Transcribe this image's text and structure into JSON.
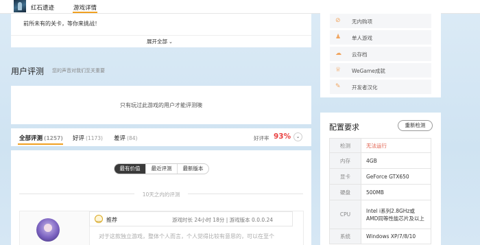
{
  "header": {
    "game_name": "红石遗迹",
    "tab_detail": "游戏详情"
  },
  "intro": {
    "text": "前所未有的关卡，等你来挑战！",
    "expand_label": "展开全部"
  },
  "reviews_section": {
    "title": "用户评测",
    "subtitle": "您的声音对我们至关重要",
    "notice": "只有玩过此游戏的用户才能评测噢",
    "tabs": [
      {
        "label": "全部评测",
        "count": "(1257)"
      },
      {
        "label": "好评",
        "count": "(1173)"
      },
      {
        "label": "差评",
        "count": "(84)"
      }
    ],
    "rate_label": "好评率",
    "rate_value": "93%",
    "sort_options": [
      "最有价值",
      "最近评测",
      "最新版本"
    ],
    "period_label": "10天之内的评测",
    "review": {
      "verdict": "推荐",
      "meta": "游戏时长 24小时 18分 | 游戏版本 0.0.0.24",
      "snippet": "对于这款独立游戏，整体个人而言，个人觉得比较有意思的，可以在至个"
    }
  },
  "features": [
    {
      "icon": "globe-off-icon",
      "label": "无内购项"
    },
    {
      "icon": "single-player-icon",
      "label": "单人游戏"
    },
    {
      "icon": "cloud-save-icon",
      "label": "云存档"
    },
    {
      "icon": "trophy-icon",
      "label": "WeGame成就"
    },
    {
      "icon": "edit-icon",
      "label": "开发者汉化"
    }
  ],
  "config": {
    "title": "配置要求",
    "recheck_label": "重新检测",
    "rows": [
      {
        "key": "检测",
        "value": "无法运行",
        "status": "warn"
      },
      {
        "key": "内存",
        "value": "4GB",
        "status": ""
      },
      {
        "key": "显卡",
        "value": "GeForce GTX650",
        "status": ""
      },
      {
        "key": "硬盘",
        "value": "500MB",
        "status": ""
      },
      {
        "key": "CPU",
        "value": "Intel i系列2.8GHz或AMD同等性能芯片及以上",
        "status": ""
      },
      {
        "key": "系统",
        "value": "Windows XP/7/8/10",
        "status": ""
      }
    ]
  },
  "colors": {
    "accent": "#f0a020",
    "rate": "#e94040",
    "warn": "#e05a47",
    "background": "#d6e7f4"
  }
}
